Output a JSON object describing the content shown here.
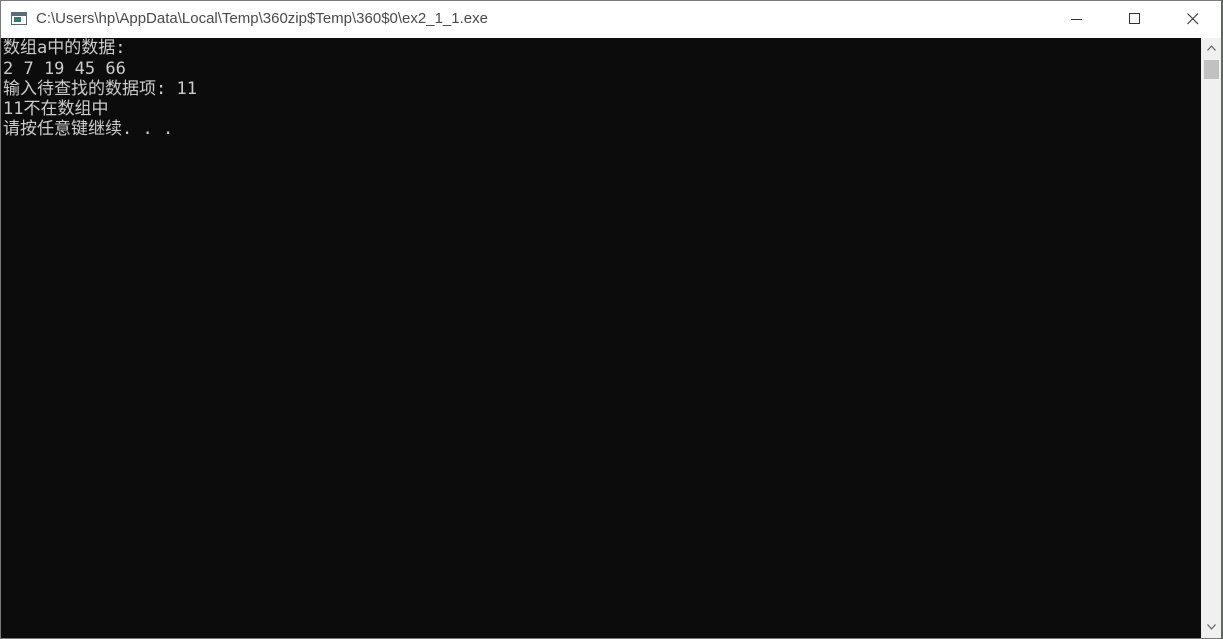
{
  "window": {
    "title": "C:\\Users\\hp\\AppData\\Local\\Temp\\360zip$Temp\\360$0\\ex2_1_1.exe",
    "icon": "console-app-icon",
    "controls": {
      "minimize_icon": "minimize-icon",
      "maximize_icon": "maximize-icon",
      "close_icon": "close-icon"
    }
  },
  "console": {
    "lines": [
      "数组a中的数据:",
      "2 7 19 45 66",
      "输入待查找的数据项: 11",
      "11不在数组中",
      "请按任意键继续. . ."
    ],
    "text_color": "#cccccc",
    "background_color": "#0c0c0c"
  }
}
